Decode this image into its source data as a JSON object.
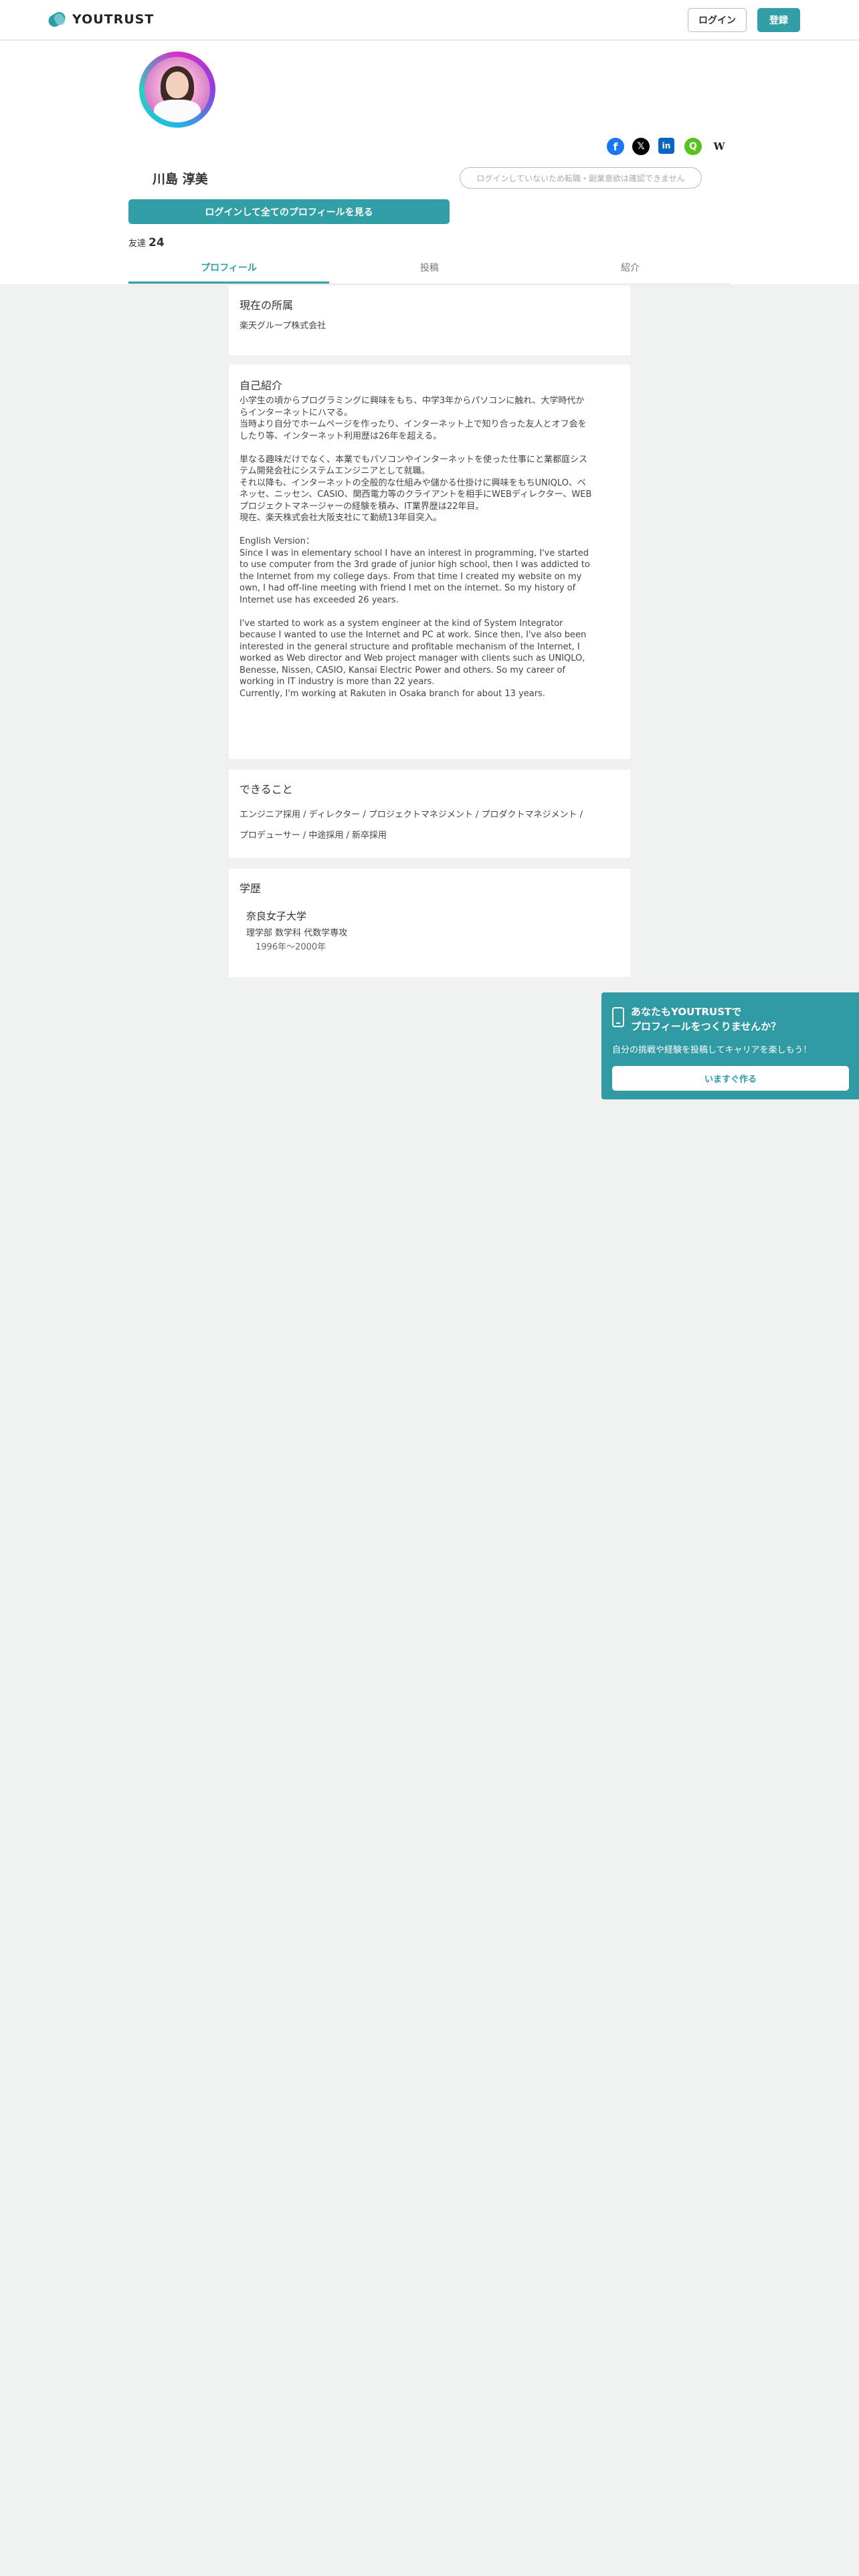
{
  "header": {
    "brand": "YOUTRUST",
    "login_label": "ログイン",
    "register_label": "登録"
  },
  "profile": {
    "name": "川島 淳美",
    "follow_notice": "ログインしていないため転職・副業意欲は確認できません",
    "see_all_label": "ログインして全てのプロフィールを見る",
    "friends_label": "友達",
    "friends_count": "24",
    "social": [
      {
        "name": "facebook-icon",
        "glyph": "f"
      },
      {
        "name": "x-icon",
        "glyph": "𝕏"
      },
      {
        "name": "linkedin-icon",
        "glyph": "in"
      },
      {
        "name": "qiita-icon",
        "glyph": "Q"
      },
      {
        "name": "wantedly-icon",
        "glyph": "W"
      }
    ]
  },
  "tabs": [
    "プロフィール",
    "投稿",
    "紹介"
  ],
  "sections": {
    "current": {
      "title": "現在の所属",
      "value": "楽天グループ株式会社"
    },
    "intro": {
      "title": "自己紹介",
      "body": "小学生の頃からプログラミングに興味をもち、中学3年からパソコンに触れ、大学時代か\nらインターネットにハマる。\n当時より自分でホームページを作ったり、インターネット上で知り合った友人とオフ会を\nしたり等、インターネット利用歴は26年を超える。\n\n単なる趣味だけでなく、本業でもパソコンやインターネットを使った仕事にと業都庭シス\nテム開発会社にシステムエンジニアとして就職。\nそれ以降も、インターネットの全般的な仕組みや儲かる仕掛けに興味をもちUNIQLO、ベ\nネッセ、ニッセン、CASIO、関西電力等のクライアントを相手にWEBディレクター、WEB\nプロジェクトマネージャーの経験を積み、IT業界歴は22年目。\n現在、楽天株式会社大阪支社にて勤続13年目突入。\n\nEnglish Version：\nSince I was in elementary school I have an interest in programming, I've started\nto use computer from the 3rd grade of junior high school, then I was addicted to\nthe Internet from my college days. From that time I created my website on my\nown, I had off-line meeting with friend I met on the internet. So my history of\nInternet use has exceeded 26 years.\n\nI've started to work as a system engineer at the kind of System Integrator\nbecause I wanted to use the Internet and PC at work. Since then, I've also been\ninterested in the general structure and profitable mechanism of the Internet, I\nworked as Web director and Web project manager with clients such as UNIQLO,\nBenesse, Nissen, CASIO, Kansai Electric Power and others. So my career of\nworking in IT industry is more than 22 years.\nCurrently, I'm working at Rakuten in Osaka branch for about 13 years."
    },
    "skills": {
      "title": "できること",
      "body": "エンジニア採用 / ディレクター / プロジェクトマネジメント / プロダクトマネジメント /\nプロデューサー / 中途採用 / 新卒採用"
    },
    "education": {
      "title": "学歴",
      "school": "奈良女子大学",
      "faculty": "理学部 数学科 代数学専攻",
      "period": "1996年〜2000年"
    }
  },
  "promo": {
    "title": "あなたもYOUTRUSTで\nプロフィールをつくりませんか？",
    "subtitle": "自分の挑戦や経験を投稿してキャリアを楽しもう！",
    "button_label": "いますぐ作る"
  }
}
